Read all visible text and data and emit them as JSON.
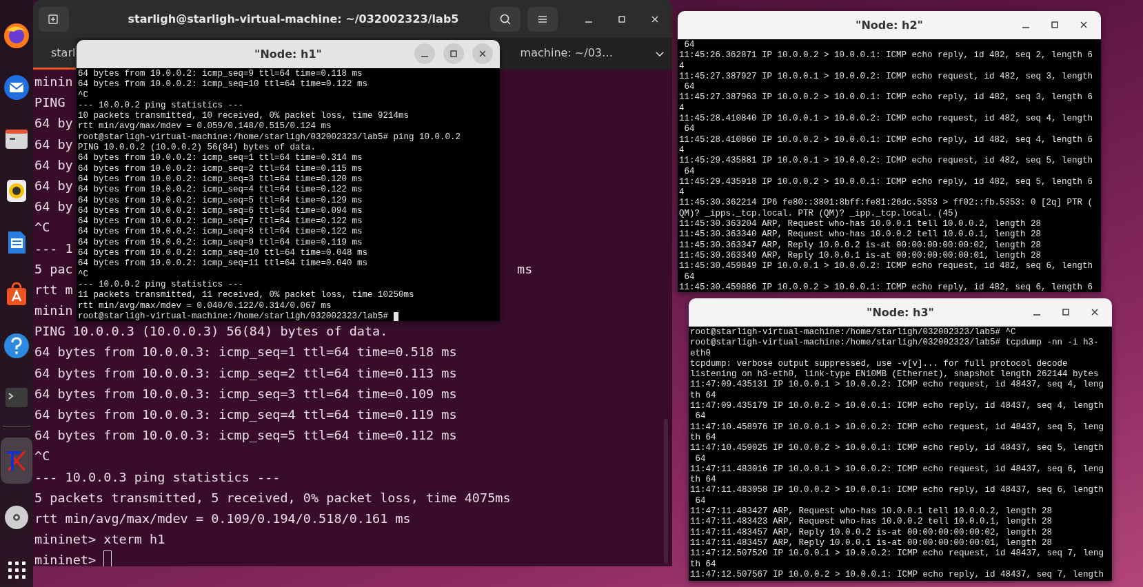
{
  "dock": {
    "items": [
      {
        "kind": "globe",
        "selected": false
      },
      {
        "kind": "mail",
        "selected": false
      },
      {
        "kind": "drawer",
        "selected": false
      },
      {
        "kind": "speaker",
        "selected": false
      },
      {
        "kind": "document",
        "selected": false
      },
      {
        "kind": "bag",
        "selected": false
      },
      {
        "kind": "help",
        "selected": false
      },
      {
        "kind": "terminal",
        "selected": false
      },
      {
        "kind": "strokes",
        "selected": true
      },
      {
        "kind": "disc",
        "selected": false
      },
      {
        "kind": "grid",
        "selected": false
      }
    ]
  },
  "main_terminal": {
    "title": "starligh@starligh-virtual-machine: ~/032002323/lab5",
    "tabs": [
      {
        "label": "starl",
        "selected": true
      },
      {
        "label": "machine: ~/03…",
        "selected": false
      }
    ],
    "focused": false,
    "lines": [
      {
        "text": "minin"
      },
      {
        "text": "PING"
      },
      {
        "text": "64 by"
      },
      {
        "text": "64 by"
      },
      {
        "text": "64 by"
      },
      {
        "text": "64 by"
      },
      {
        "text": "64 by"
      },
      {
        "text": "^C"
      },
      {
        "text": "--- 1"
      },
      {
        "text": "5 pac",
        "tail": "ms"
      },
      {
        "text": "rtt m"
      },
      {
        "text": "minin"
      },
      {
        "text": "PING 10.0.0.3 (10.0.0.3) 56(84) bytes of data."
      },
      {
        "text": "64 bytes from 10.0.0.3: icmp_seq=1 ttl=64 time=0.518 ms"
      },
      {
        "text": "64 bytes from 10.0.0.3: icmp_seq=2 ttl=64 time=0.113 ms"
      },
      {
        "text": "64 bytes from 10.0.0.3: icmp_seq=3 ttl=64 time=0.109 ms"
      },
      {
        "text": "64 bytes from 10.0.0.3: icmp_seq=4 ttl=64 time=0.119 ms"
      },
      {
        "text": "64 bytes from 10.0.0.3: icmp_seq=5 ttl=64 time=0.112 ms"
      },
      {
        "text": "^C"
      },
      {
        "text": "--- 10.0.0.3 ping statistics ---"
      },
      {
        "text": "5 packets transmitted, 5 received, 0% packet loss, time 4075ms"
      },
      {
        "text": "rtt min/avg/max/mdev = 0.109/0.194/0.518/0.161 ms"
      },
      {
        "text": "mininet> xterm h1"
      },
      {
        "text": "mininet>"
      }
    ]
  },
  "xterms": [
    {
      "title": "\"Node: h1\"",
      "focused": true,
      "lines": [
        "64 bytes from 10.0.0.2: icmp_seq=9 ttl=64 time=0.118 ms",
        "64 bytes from 10.0.0.2: icmp_seq=10 ttl=64 time=0.122 ms",
        "^C",
        "--- 10.0.0.2 ping statistics ---",
        "10 packets transmitted, 10 received, 0% packet loss, time 9214ms",
        "rtt min/avg/max/mdev = 0.059/0.148/0.515/0.124 ms",
        "root@starligh-virtual-machine:/home/starligh/032002323/lab5# ping 10.0.0.2",
        "PING 10.0.0.2 (10.0.0.2) 56(84) bytes of data.",
        "64 bytes from 10.0.0.2: icmp_seq=1 ttl=64 time=0.314 ms",
        "64 bytes from 10.0.0.2: icmp_seq=2 ttl=64 time=0.115 ms",
        "64 bytes from 10.0.0.2: icmp_seq=3 ttl=64 time=0.120 ms",
        "64 bytes from 10.0.0.2: icmp_seq=4 ttl=64 time=0.122 ms",
        "64 bytes from 10.0.0.2: icmp_seq=5 ttl=64 time=0.129 ms",
        "64 bytes from 10.0.0.2: icmp_seq=6 ttl=64 time=0.094 ms",
        "64 bytes from 10.0.0.2: icmp_seq=7 ttl=64 time=0.122 ms",
        "64 bytes from 10.0.0.2: icmp_seq=8 ttl=64 time=0.122 ms",
        "64 bytes from 10.0.0.2: icmp_seq=9 ttl=64 time=0.119 ms",
        "64 bytes from 10.0.0.2: icmp_seq=10 ttl=64 time=0.048 ms",
        "64 bytes from 10.0.0.2: icmp_seq=11 ttl=64 time=0.040 ms",
        "^C",
        "--- 10.0.0.2 ping statistics ---",
        "11 packets transmitted, 11 received, 0% packet loss, time 10250ms",
        "rtt min/avg/max/mdev = 0.040/0.122/0.314/0.067 ms",
        "root@starligh-virtual-machine:/home/starligh/032002323/lab5#"
      ]
    },
    {
      "title": "\"Node: h2\"",
      "focused": false,
      "lines": [
        " 64",
        "11:45:26.362871 IP 10.0.0.2 > 10.0.0.1: ICMP echo reply, id 482, seq 2, length 6",
        "4",
        "11:45:27.387927 IP 10.0.0.1 > 10.0.0.2: ICMP echo request, id 482, seq 3, length",
        " 64",
        "11:45:27.387963 IP 10.0.0.2 > 10.0.0.1: ICMP echo reply, id 482, seq 3, length 6",
        "4",
        "11:45:28.410840 IP 10.0.0.1 > 10.0.0.2: ICMP echo request, id 482, seq 4, length",
        " 64",
        "11:45:28.410860 IP 10.0.0.2 > 10.0.0.1: ICMP echo reply, id 482, seq 4, length 6",
        "4",
        "11:45:29.435881 IP 10.0.0.1 > 10.0.0.2: ICMP echo request, id 482, seq 5, length",
        " 64",
        "11:45:29.435918 IP 10.0.0.2 > 10.0.0.1: ICMP echo reply, id 482, seq 5, length 6",
        "4",
        "11:45:30.362214 IP6 fe80::3801:8bff:fe81:26dc.5353 > ff02::fb.5353: 0 [2q] PTR (",
        "QM)? _ipps._tcp.local. PTR (QM)? _ipp._tcp.local. (45)",
        "11:45:30.363204 ARP, Request who-has 10.0.0.1 tell 10.0.0.2, length 28",
        "11:45:30.363340 ARP, Request who-has 10.0.0.2 tell 10.0.0.1, length 28",
        "11:45:30.363347 ARP, Reply 10.0.0.2 is-at 00:00:00:00:00:02, length 28",
        "11:45:30.363349 ARP, Reply 10.0.0.1 is-at 00:00:00:00:00:01, length 28",
        "11:45:30.459849 IP 10.0.0.1 > 10.0.0.2: ICMP echo request, id 482, seq 6, length",
        " 64",
        "11:45:30.459886 IP 10.0.0.2 > 10.0.0.1: ICMP echo reply, id 482, seq 6, length 6"
      ]
    },
    {
      "title": "\"Node: h3\"",
      "focused": false,
      "lines": [
        "root@starligh-virtual-machine:/home/starligh/032002323/lab5# ^C",
        "root@starligh-virtual-machine:/home/starligh/032002323/lab5# tcpdump -nn -i h3-",
        "eth0",
        "tcpdump: verbose output suppressed, use -v[v]... for full protocol decode",
        "listening on h3-eth0, link-type EN10MB (Ethernet), snapshot length 262144 bytes",
        "11:47:09.435131 IP 10.0.0.1 > 10.0.0.2: ICMP echo request, id 48437, seq 4, leng",
        "th 64",
        "11:47:09.435179 IP 10.0.0.2 > 10.0.0.1: ICMP echo reply, id 48437, seq 4, length",
        " 64",
        "11:47:10.458976 IP 10.0.0.1 > 10.0.0.2: ICMP echo request, id 48437, seq 5, leng",
        "th 64",
        "11:47:10.459025 IP 10.0.0.2 > 10.0.0.1: ICMP echo reply, id 48437, seq 5, length",
        " 64",
        "11:47:11.483016 IP 10.0.0.1 > 10.0.0.2: ICMP echo request, id 48437, seq 6, leng",
        "th 64",
        "11:47:11.483058 IP 10.0.0.2 > 10.0.0.1: ICMP echo reply, id 48437, seq 6, length",
        " 64",
        "11:47:11.483427 ARP, Request who-has 10.0.0.1 tell 10.0.0.2, length 28",
        "11:47:11.483423 ARP, Request who-has 10.0.0.2 tell 10.0.0.1, length 28",
        "11:47:11.483457 ARP, Reply 10.0.0.2 is-at 00:00:00:00:00:02, length 28",
        "11:47:11.483457 ARP, Reply 10.0.0.1 is-at 00:00:00:00:00:01, length 28",
        "11:47:12.507520 IP 10.0.0.1 > 10.0.0.2: ICMP echo request, id 48437, seq 7, leng",
        "th 64",
        "11:47:12.507567 IP 10.0.0.2 > 10.0.0.1: ICMP echo reply, id 48437, seq 7, length"
      ]
    }
  ]
}
